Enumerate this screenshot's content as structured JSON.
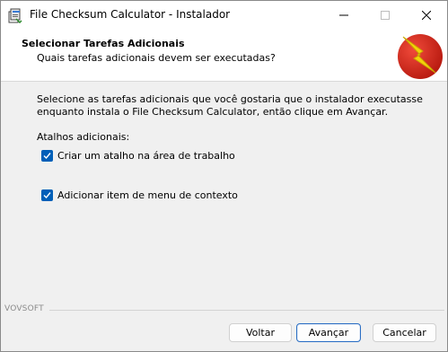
{
  "window": {
    "title": "File Checksum Calculator - Instalador",
    "icon": "installer-icon",
    "controls": [
      "minimize-icon",
      "maximize-icon",
      "close-icon"
    ]
  },
  "header": {
    "title": "Selecionar Tarefas Adicionais",
    "subtitle": "Quais tarefas adicionais devem ser executadas?",
    "logo_icon": "lightning-logo"
  },
  "body": {
    "description_line1": "Selecione as tarefas adicionais que você gostaria que o instalador executasse",
    "description_line2": "enquanto instala o File Checksum Calculator, então clique em Avançar.",
    "section_label": "Atalhos adicionais:",
    "tasks": [
      {
        "label": "Criar um atalho na área de trabalho",
        "checked": true
      },
      {
        "label": "Adicionar item de menu de contexto",
        "checked": true
      }
    ]
  },
  "footer": {
    "brand": "VOVSOFT",
    "back_label": "Voltar",
    "next_label": "Avançar",
    "cancel_label": "Cancelar"
  },
  "colors": {
    "accent": "#005fb8",
    "logo_red": "#d92a1c",
    "logo_yellow": "#f5d20a"
  }
}
